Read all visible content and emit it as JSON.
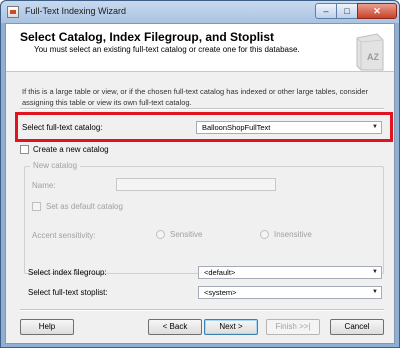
{
  "window": {
    "title": "Full-Text Indexing Wizard",
    "minimize_glyph": "–",
    "maximize_glyph": "□",
    "close_glyph": "✕"
  },
  "header": {
    "title": "Select Catalog, Index Filegroup, and Stoplist",
    "subtitle": "You must select an existing full-text catalog or create one for this database.",
    "icon": "book-az-icon",
    "icon_letters": "AZ"
  },
  "info_text": {
    "line1": "If this is a large table or view, or if the chosen full-text catalog has indexed or other large tables, consider",
    "line2": "assigning this table or view its own full-text catalog."
  },
  "catalog": {
    "label": "Select full-text catalog:",
    "value": "BalloonShopFullText"
  },
  "create_new": {
    "label": "Create a new catalog",
    "checked": false
  },
  "new_catalog": {
    "legend": "New catalog",
    "name_label": "Name:",
    "name_value": "",
    "default_label": "Set as default catalog",
    "accent_label": "Accent sensitivity:",
    "sensitive_label": "Sensitive",
    "insensitive_label": "Insensitive"
  },
  "filegroup": {
    "label": "Select index filegroup:",
    "value": "<default>"
  },
  "stoplist": {
    "label": "Select full-text stoplist:",
    "value": "<system>"
  },
  "buttons": {
    "help": "Help",
    "back": "< Back",
    "next": "Next >",
    "finish": "Finish >>|",
    "cancel": "Cancel"
  },
  "colors": {
    "highlight_border": "#e0141e",
    "disabled_text": "#a0a0a0"
  }
}
